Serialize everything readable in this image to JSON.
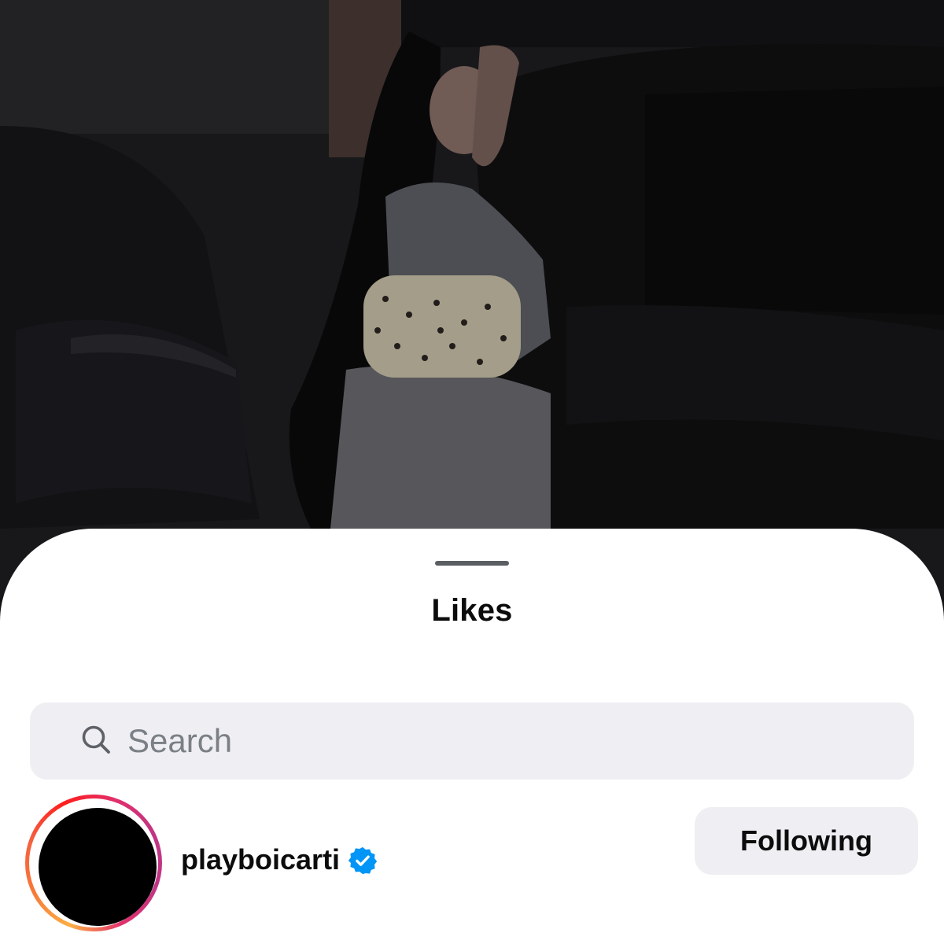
{
  "background_photo": {
    "description_icon": "post-photo-image"
  },
  "sheet": {
    "title": "Likes"
  },
  "search": {
    "placeholder": "Search",
    "icon": "search-icon"
  },
  "likers": [
    {
      "username": "playboicarti",
      "verified": true,
      "story_ring": true,
      "button_label": "Following"
    }
  ],
  "colors": {
    "sheet_bg": "#ffffff",
    "search_bg": "#efeff3",
    "button_bg": "#efeff3",
    "verified_blue": "#0095f6",
    "text_primary": "#0c0c0d",
    "placeholder": "#7b7f86",
    "grabber": "#5b5f63"
  }
}
